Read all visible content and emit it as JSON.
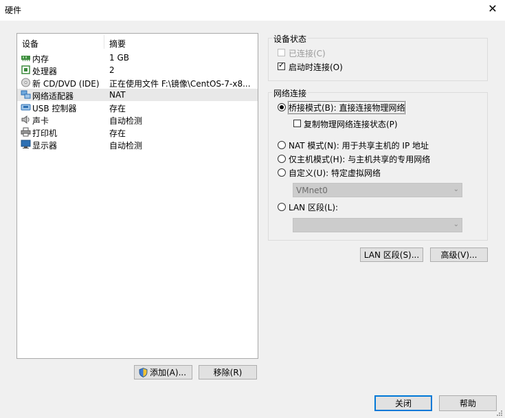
{
  "window": {
    "title": "硬件",
    "close_glyph": "✕"
  },
  "device_list": {
    "col_device": "设备",
    "col_summary": "摘要",
    "items": [
      {
        "name": "内存",
        "summary": "1 GB",
        "icon": "memory-icon",
        "color": "#3d8b3d"
      },
      {
        "name": "处理器",
        "summary": "2",
        "icon": "cpu-icon",
        "color": "#3d8b3d"
      },
      {
        "name": "新 CD/DVD (IDE)",
        "summary": "正在使用文件 F:\\镜像\\CentOS-7-x8...",
        "icon": "cd-icon",
        "color": "#888888"
      },
      {
        "name": "网络适配器",
        "summary": "NAT",
        "icon": "network-adapter-icon",
        "color": "#2c6fb3"
      },
      {
        "name": "USB 控制器",
        "summary": "存在",
        "icon": "usb-icon",
        "color": "#2c6fb3"
      },
      {
        "name": "声卡",
        "summary": "自动检测",
        "icon": "speaker-icon",
        "color": "#555555"
      },
      {
        "name": "打印机",
        "summary": "存在",
        "icon": "printer-icon",
        "color": "#555555"
      },
      {
        "name": "显示器",
        "summary": "自动检测",
        "icon": "monitor-icon",
        "color": "#2c6fb3"
      }
    ],
    "selected_index": 3
  },
  "buttons": {
    "add": "添加(A)...",
    "remove": "移除(R)",
    "lan_segments": "LAN 区段(S)...",
    "advanced": "高级(V)...",
    "close": "关闭",
    "help": "帮助"
  },
  "device_status": {
    "title": "设备状态",
    "connected": {
      "label": "已连接(C)",
      "checked": false,
      "disabled": true
    },
    "connect_at_power_on": {
      "label": "启动时连接(O)",
      "checked": true
    }
  },
  "network_connection": {
    "title": "网络连接",
    "bridged": {
      "label": "桥接模式(B): 直接连接物理网络",
      "selected": true
    },
    "replicate": {
      "label": "复制物理网络连接状态(P)",
      "checked": false
    },
    "nat": {
      "label": "NAT 模式(N): 用于共享主机的 IP 地址",
      "selected": false
    },
    "host_only": {
      "label": "仅主机模式(H): 与主机共享的专用网络",
      "selected": false
    },
    "custom": {
      "label": "自定义(U): 特定虚拟网络",
      "selected": false
    },
    "custom_value": "VMnet0",
    "lan_segment": {
      "label": "LAN 区段(L):",
      "selected": false
    },
    "lan_segment_value": ""
  }
}
